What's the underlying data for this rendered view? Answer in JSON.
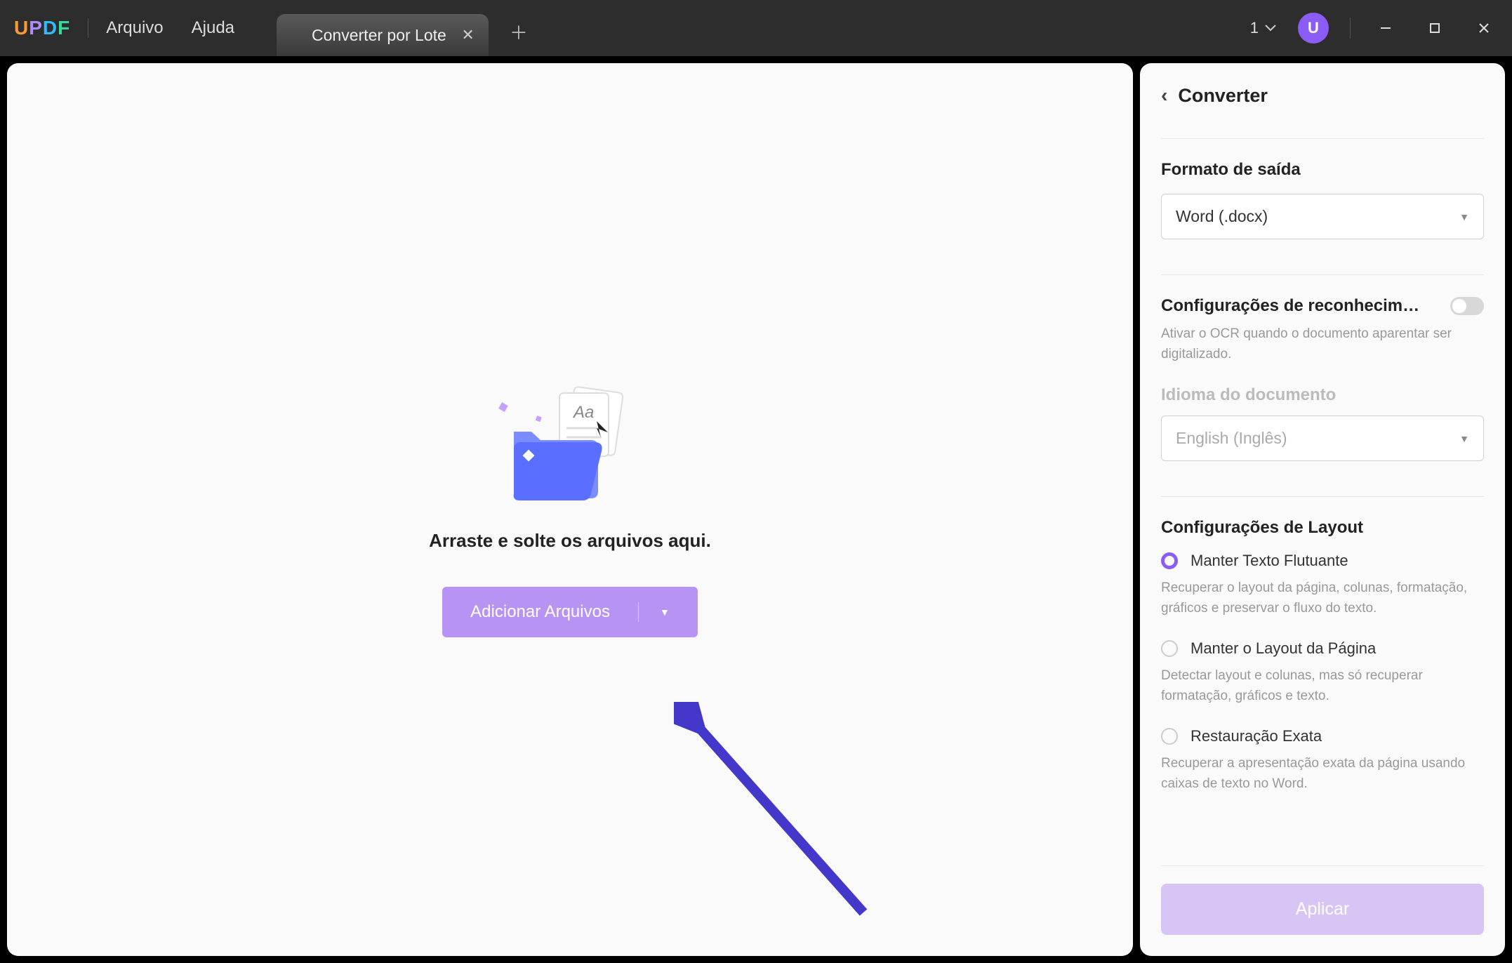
{
  "menu": {
    "file": "Arquivo",
    "help": "Ajuda"
  },
  "tab": {
    "title": "Converter por Lote"
  },
  "titlebar": {
    "count": "1",
    "avatar": "U"
  },
  "main": {
    "drop_text": "Arraste e solte os arquivos aqui.",
    "add_button": "Adicionar Arquivos"
  },
  "panel": {
    "title": "Converter",
    "output_format_label": "Formato de saída",
    "output_format_value": "Word (.docx)",
    "ocr_label": "Configurações de reconhecimen…",
    "ocr_help": "Ativar o OCR quando o documento aparentar ser digitalizado.",
    "doc_lang_label": "Idioma do documento",
    "doc_lang_value": "English (Inglês)",
    "layout_label": "Configurações de Layout",
    "opt1_label": "Manter Texto Flutuante",
    "opt1_desc": "Recuperar o layout da página, colunas, formatação, gráficos e preservar o fluxo do texto.",
    "opt2_label": "Manter o Layout da Página",
    "opt2_desc": "Detectar layout e colunas, mas só recuperar formatação, gráficos e texto.",
    "opt3_label": "Restauração Exata",
    "opt3_desc": "Recuperar a apresentação exata da página usando caixas de texto no Word.",
    "apply": "Aplicar"
  }
}
